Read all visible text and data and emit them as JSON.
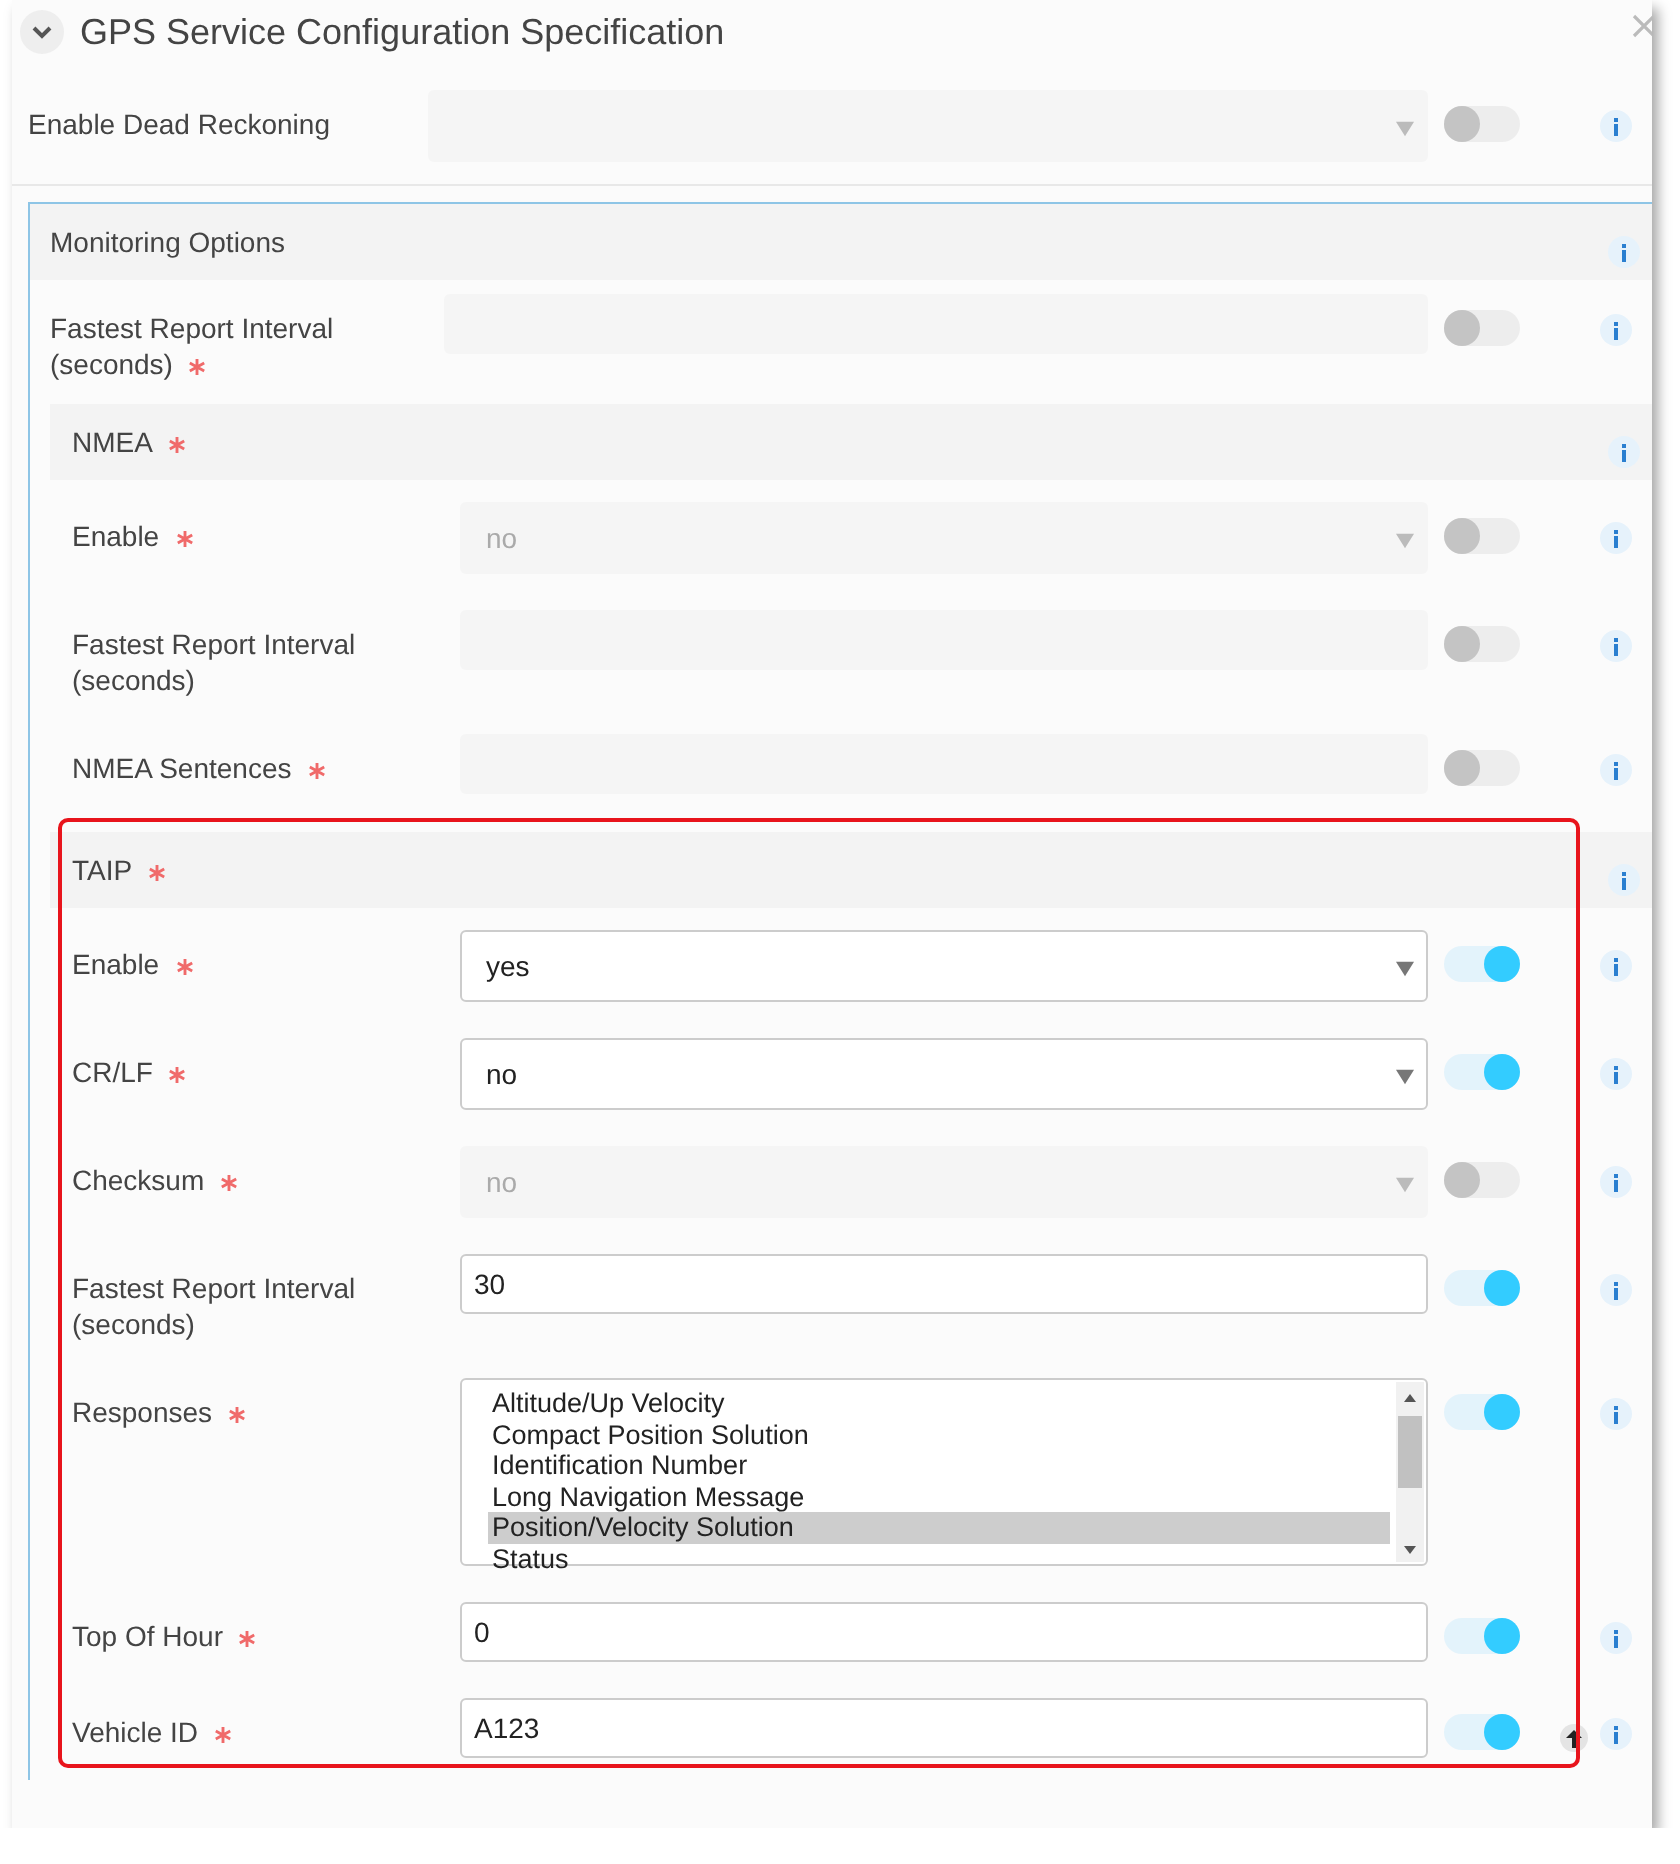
{
  "window": {
    "title": "GPS Service Configuration Specification",
    "expanded": true
  },
  "top_rows": [
    {
      "label": "Enable Dead Reckoning",
      "required": false,
      "kind": "select",
      "value": "",
      "disabled": true,
      "on": false
    }
  ],
  "monitoring": {
    "title": "Monitoring Options",
    "rows": [
      {
        "label": "Fastest Report Interval (seconds)",
        "required": true,
        "kind": "input",
        "value": "",
        "disabled": true,
        "on": false
      }
    ],
    "groups": [
      {
        "title": "NMEA",
        "required": true,
        "highlighted": false,
        "rows": [
          {
            "label": "Enable",
            "required": true,
            "kind": "select",
            "value": "no",
            "disabled": true,
            "on": false
          },
          {
            "label": "Fastest Report Interval (seconds)",
            "required": false,
            "kind": "input",
            "value": "",
            "disabled": true,
            "on": false
          },
          {
            "label": "NMEA Sentences",
            "required": true,
            "kind": "input",
            "value": "",
            "disabled": true,
            "on": false
          }
        ]
      },
      {
        "title": "TAIP",
        "required": true,
        "highlighted": true,
        "rows": [
          {
            "label": "Enable",
            "required": true,
            "kind": "select",
            "value": "yes",
            "disabled": false,
            "on": true
          },
          {
            "label": "CR/LF",
            "required": true,
            "kind": "select",
            "value": "no",
            "disabled": false,
            "on": true
          },
          {
            "label": "Checksum",
            "required": true,
            "kind": "select",
            "value": "no",
            "disabled": true,
            "on": false
          },
          {
            "label": "Fastest Report Interval (seconds)",
            "required": false,
            "kind": "input",
            "value": "30",
            "disabled": false,
            "on": true
          },
          {
            "label": "Responses",
            "required": true,
            "kind": "listbox",
            "disabled": false,
            "on": true,
            "options": [
              {
                "label": "Altitude/Up Velocity",
                "selected": false
              },
              {
                "label": "Compact Position Solution",
                "selected": false
              },
              {
                "label": "Identification Number",
                "selected": false
              },
              {
                "label": "Long Navigation Message",
                "selected": false
              },
              {
                "label": "Position/Velocity Solution",
                "selected": true
              },
              {
                "label": "Status",
                "selected": false
              }
            ]
          },
          {
            "label": "Top Of Hour",
            "required": true,
            "kind": "input",
            "value": "0",
            "disabled": false,
            "on": true
          },
          {
            "label": "Vehicle ID",
            "required": true,
            "kind": "input",
            "value": "A123",
            "disabled": false,
            "on": true,
            "back_to_top": true
          }
        ]
      }
    ]
  }
}
